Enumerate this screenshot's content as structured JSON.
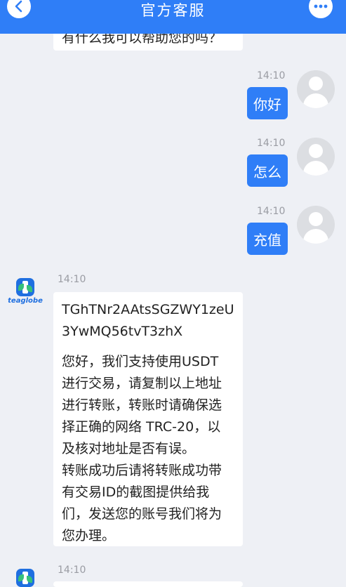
{
  "header": {
    "title": "官方客服",
    "back_icon": "chevron-left-icon",
    "more_icon": "more-horizontal-icon",
    "accent": "#2f7ef7"
  },
  "messages": [
    {
      "from": "agent",
      "text": "有什么我可以帮助您的吗？"
    },
    {
      "from": "user",
      "time": "14:10",
      "text": "你好"
    },
    {
      "from": "user",
      "time": "14:10",
      "text": "怎么"
    },
    {
      "from": "user",
      "time": "14:10",
      "text": "充值"
    },
    {
      "from": "agent",
      "time": "14:10",
      "address": "TGhTNr2AAtsSGZWY1zeU\n3YwMQ56tvT3zhX",
      "text": "您好，我们支持使用USDT\n进行交易，请复制以上地址\n进行转账，转账时请确保选\n择正确的网络 TRC-20，以\n及核对地址是否有误。\n转账成功后请将转账成功带\n有交易ID的截图提供给我\n们，发送您的账号我们将为\n您办理。"
    },
    {
      "from": "agent",
      "time": "14:10",
      "text": ""
    }
  ],
  "agent_brand": "teaglobe"
}
